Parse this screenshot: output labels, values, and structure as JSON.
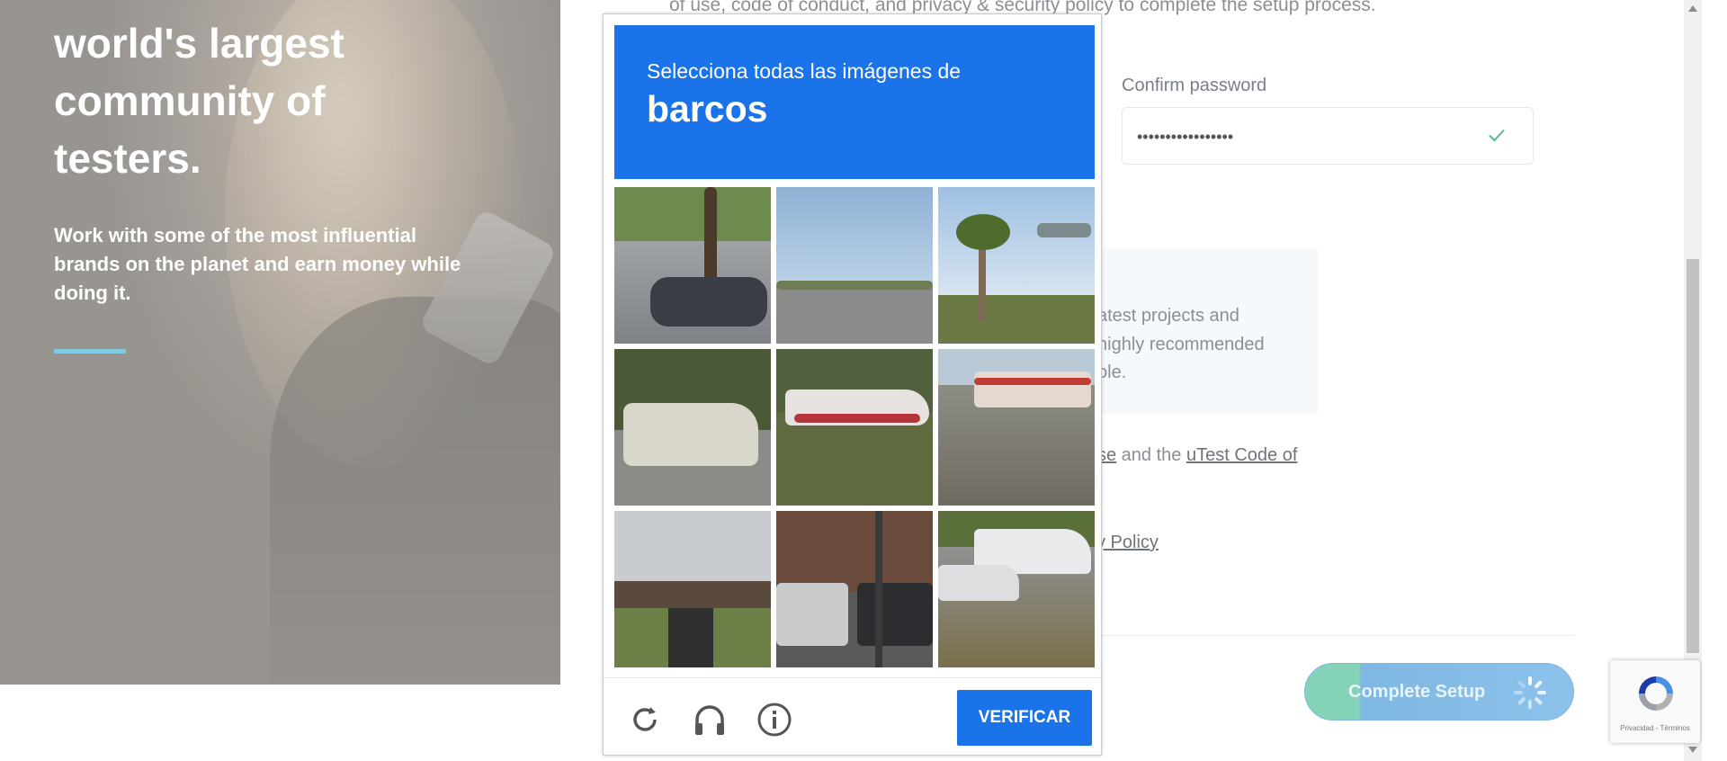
{
  "hero": {
    "title": "world's largest community of testers.",
    "subtitle": "Work with some of the most influential brands on the planet and earn money while doing it."
  },
  "form": {
    "policy_text": "of use, code of conduct, and privacy & security policy to complete the setup process.",
    "confirm_password_label": "Confirm password",
    "confirm_password_value": "•••••••••••••••••",
    "info_lines": [
      "atest projects and",
      "highly recommended",
      "ole."
    ],
    "agree_prefix": "se",
    "agree_middle": " and the ",
    "agree_link": "uTest Code of",
    "privacy_link": "y Policy",
    "complete_button": "Complete Setup"
  },
  "captcha": {
    "instruction": "Selecciona todas las imágenes de",
    "object": "barcos",
    "verify_button": "VERIFICAR",
    "tiles": [
      {
        "desc": "car-on-street"
      },
      {
        "desc": "road"
      },
      {
        "desc": "palm-tree-sign"
      },
      {
        "desc": "boat-on-trailer"
      },
      {
        "desc": "boat-on-trailer-red"
      },
      {
        "desc": "bus-on-highway"
      },
      {
        "desc": "overpass"
      },
      {
        "desc": "cars-and-traffic-light"
      },
      {
        "desc": "boats-in-lot"
      }
    ]
  },
  "recaptcha_badge": {
    "terms": "Privacidad - Términos"
  },
  "colors": {
    "captcha_blue": "#1a73e8",
    "accent_teal": "#7fcbe0",
    "check_green": "#4fc08d"
  }
}
